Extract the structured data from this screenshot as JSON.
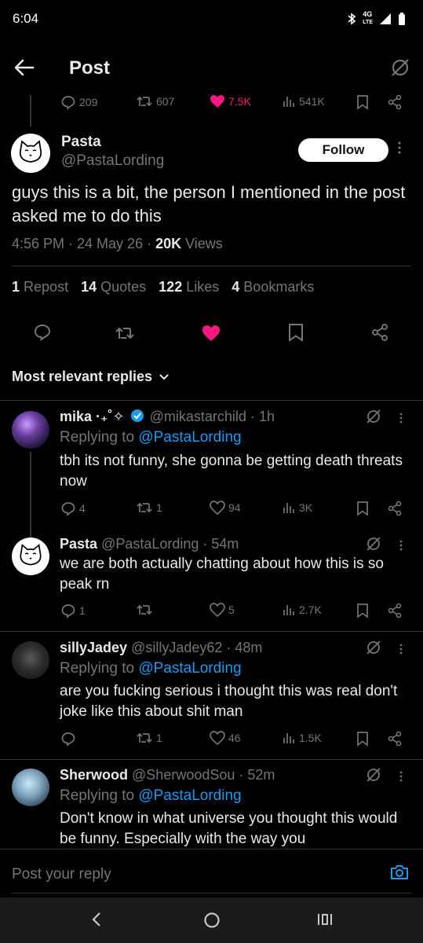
{
  "status": {
    "time": "6:04",
    "network": "4G LTE"
  },
  "header": {
    "title": "Post"
  },
  "parent_stats": {
    "replies": "209",
    "reposts": "607",
    "likes": "7.5K",
    "views": "541K"
  },
  "tweet": {
    "name": "Pasta",
    "handle": "@PastaLording",
    "follow_label": "Follow",
    "text": "guys this is a bit, the person I mentioned in the post asked me to do this",
    "time": "4:56 PM · 24 May 26 · ",
    "views_count": "20K",
    "views_label": " Views",
    "counts": [
      {
        "num": "1",
        "label": "Repost"
      },
      {
        "num": "14",
        "label": "Quotes"
      },
      {
        "num": "122",
        "label": "Likes"
      },
      {
        "num": "4",
        "label": "Bookmarks"
      }
    ]
  },
  "sort_label": "Most relevant replies",
  "replies": [
    {
      "name": "mika ·₊˚✧",
      "handle": "@mikastarchild · 1h",
      "verified": true,
      "replying_prefix": "Replying to ",
      "replying_to": "@PastaLording",
      "text": "tbh its not funny, she gonna be getting death threats now",
      "replies": "4",
      "reposts": "1",
      "likes": "94",
      "views": "3K"
    },
    {
      "name": "Pasta",
      "handle": "@PastaLording · 54m",
      "text": "we are both actually chatting about how this is so peak rn",
      "replies": "1",
      "reposts": "",
      "likes": "5",
      "views": "2.7K"
    },
    {
      "name": "sillyJadey",
      "handle": "@sillyJadey62 · 48m",
      "replying_prefix": "Replying to ",
      "replying_to": "@PastaLording",
      "text": "are you fucking serious i thought this was real don't joke like this about shit man",
      "replies": "",
      "reposts": "1",
      "likes": "46",
      "views": "1.5K"
    },
    {
      "name": "Sherwood",
      "handle": "@SherwoodSou · 52m",
      "replying_prefix": "Replying to ",
      "replying_to": "@PastaLording",
      "text": "Don't know in what universe you thought this would be funny. Especially with the way you"
    }
  ],
  "composer": {
    "placeholder": "Post your reply"
  },
  "colors": {
    "accent": "#1d9bf0",
    "like": "#f91880",
    "muted": "#71767b",
    "background": "#000000"
  }
}
